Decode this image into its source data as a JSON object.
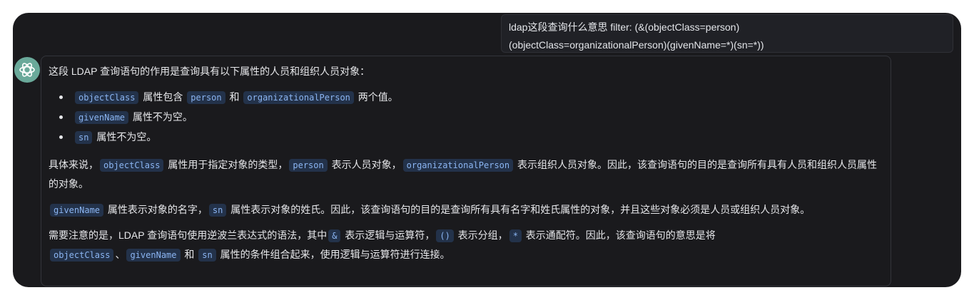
{
  "user_message": {
    "line1": "ldap这段查询什么意思    filter: (&(objectClass=person)",
    "line2": "(objectClass=organizationalPerson)(givenName=*)(sn=*))"
  },
  "reply": {
    "intro": "这段 LDAP 查询语句的作用是查询具有以下属性的人员和组织人员对象：",
    "bullets": [
      {
        "c1": "objectClass",
        "t1": " 属性包含 ",
        "c2": "person",
        "t2": " 和 ",
        "c3": "organizationalPerson",
        "t3": " 两个值。"
      },
      {
        "c1": "givenName",
        "t1": " 属性不为空。"
      },
      {
        "c1": "sn",
        "t1": " 属性不为空。"
      }
    ],
    "p2": {
      "t0": "具体来说，",
      "c1": "objectClass",
      "t1": " 属性用于指定对象的类型，",
      "c2": "person",
      "t2": " 表示人员对象，",
      "c3": "organizationalPerson",
      "t3": " 表示组织人员对象。因此，该查询语句的目的是查询所有具有人员和组织人员属性的对象。"
    },
    "p3": {
      "c1": "givenName",
      "t1": " 属性表示对象的名字，",
      "c2": "sn",
      "t2": " 属性表示对象的姓氏。因此，该查询语句的目的是查询所有具有名字和姓氏属性的对象，并且这些对象必须是人员或组织人员对象。"
    },
    "p4": {
      "t0": "需要注意的是，LDAP 查询语句使用逆波兰表达式的语法，其中",
      "c1": "&",
      "t1": " 表示逻辑与运算符，",
      "c2": "()",
      "t2": " 表示分组，",
      "c3": "*",
      "t3": " 表示通配符。因此，该查询语句的意思是将",
      "c4": "objectClass",
      "t4": "、",
      "c5": "givenName",
      "t5": " 和 ",
      "c6": "sn",
      "t6": " 属性的条件组合起来，使用逻辑与运算符进行连接。"
    }
  },
  "colors": {
    "window_bg": "#1a1a1d",
    "avatar_bg": "#6aa99a",
    "code_text": "#8bb5f2",
    "code_bg": "#23324a"
  },
  "icons": {
    "avatar": "openai-logo-icon"
  }
}
